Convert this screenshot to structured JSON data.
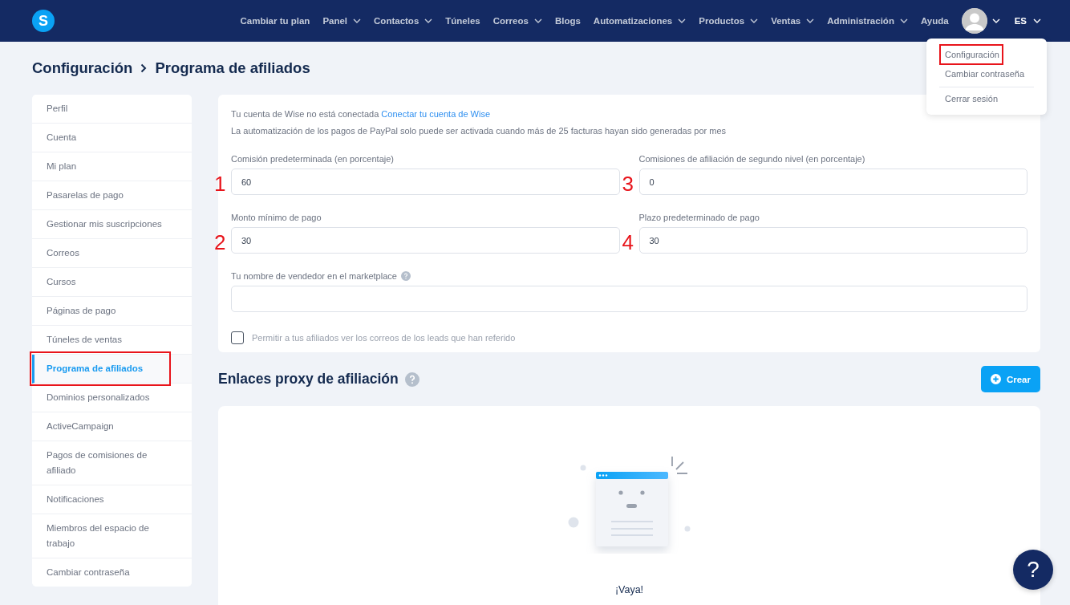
{
  "navbar": {
    "logo": "S",
    "menu": [
      {
        "label": "Cambiar tu plan",
        "dropdown": false
      },
      {
        "label": "Panel",
        "dropdown": true
      },
      {
        "label": "Contactos",
        "dropdown": true
      },
      {
        "label": "Túneles",
        "dropdown": false
      },
      {
        "label": "Correos",
        "dropdown": true
      },
      {
        "label": "Blogs",
        "dropdown": false
      },
      {
        "label": "Automatizaciones",
        "dropdown": true
      },
      {
        "label": "Productos",
        "dropdown": true
      },
      {
        "label": "Ventas",
        "dropdown": true
      },
      {
        "label": "Administración",
        "dropdown": true
      },
      {
        "label": "Ayuda",
        "dropdown": false
      }
    ],
    "language": "ES"
  },
  "user_menu": {
    "items": [
      {
        "label": "Configuración",
        "highlighted": true,
        "separated": false
      },
      {
        "label": "Cambiar contraseña",
        "highlighted": false,
        "separated": false
      },
      {
        "label": "Cerrar sesión",
        "highlighted": false,
        "separated": true
      }
    ]
  },
  "breadcrumb": [
    "Configuración",
    "Programa de afiliados"
  ],
  "sidebar": {
    "items": [
      {
        "label": "Perfil",
        "selected": false,
        "highlighted": false
      },
      {
        "label": "Cuenta",
        "selected": false,
        "highlighted": false
      },
      {
        "label": "Mi plan",
        "selected": false,
        "highlighted": false
      },
      {
        "label": "Pasarelas de pago",
        "selected": false,
        "highlighted": false
      },
      {
        "label": "Gestionar mis suscripciones",
        "selected": false,
        "highlighted": false
      },
      {
        "label": "Correos",
        "selected": false,
        "highlighted": false
      },
      {
        "label": "Cursos",
        "selected": false,
        "highlighted": false
      },
      {
        "label": "Páginas de pago",
        "selected": false,
        "highlighted": false
      },
      {
        "label": "Túneles de ventas",
        "selected": false,
        "highlighted": false
      },
      {
        "label": "Programa de afiliados",
        "selected": true,
        "highlighted": true
      },
      {
        "label": "Dominios personalizados",
        "selected": false,
        "highlighted": false
      },
      {
        "label": "ActiveCampaign",
        "selected": false,
        "highlighted": false
      },
      {
        "label": "Pagos de comisiones de afiliado",
        "selected": false,
        "highlighted": false
      },
      {
        "label": "Notificaciones",
        "selected": false,
        "highlighted": false
      },
      {
        "label": "Miembros del espacio de trabajo",
        "selected": false,
        "highlighted": false
      },
      {
        "label": "Cambiar contraseña",
        "selected": false,
        "highlighted": false
      }
    ]
  },
  "settings": {
    "wise_notice": "Tu cuenta de Wise no está conectada",
    "wise_link": "Conectar tu cuenta de Wise",
    "paypal_notice": "La automatización de los pagos de PayPal solo puede ser activada cuando más de 25 facturas hayan sido generadas por mes",
    "fields": [
      {
        "label": "Comisión predeterminada (en porcentaje)",
        "value": "60",
        "annotation": "1"
      },
      {
        "label": "Comisiones de afiliación de segundo nivel (en porcentaje)",
        "value": "0",
        "annotation": "3"
      },
      {
        "label": "Monto mínimo de pago",
        "value": "30",
        "annotation": "2"
      },
      {
        "label": "Plazo predeterminado de pago",
        "value": "30",
        "annotation": "4"
      }
    ],
    "marketplace": {
      "label": "Tu nombre de vendedor en el marketplace"
    },
    "checkbox": {
      "label": "Permitir a tus afiliados ver los correos de los leads que han referido",
      "checked": false
    }
  },
  "proxy_links": {
    "title": "Enlaces proxy de afiliación",
    "create_button": "Crear",
    "empty_title": "¡Vaya!"
  },
  "help_button": "?"
}
